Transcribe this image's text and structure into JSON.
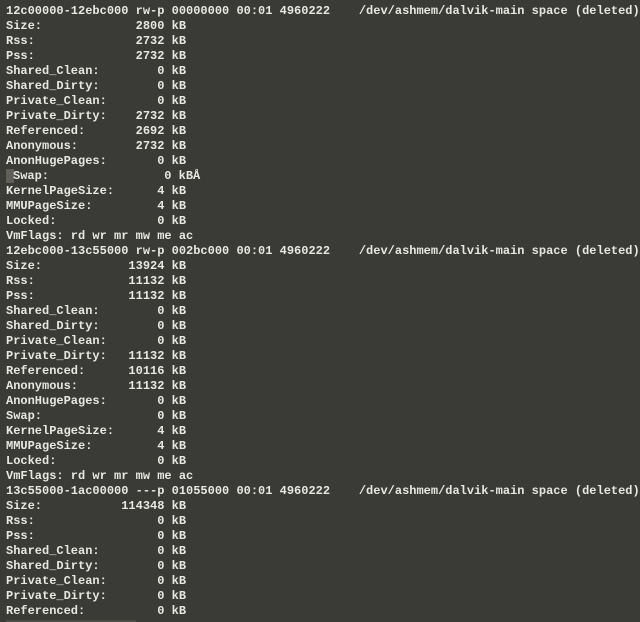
{
  "blocks": [
    {
      "header": "12c00000-12ebc000 rw-p 00000000 00:01 4960222    /dev/ashmem/dalvik-main space (deleted)",
      "entries": [
        {
          "label": "Size:",
          "value": "2800",
          "unit": "kB"
        },
        {
          "label": "Rss:",
          "value": "2732",
          "unit": "kB"
        },
        {
          "label": "Pss:",
          "value": "2732",
          "unit": "kB"
        },
        {
          "label": "Shared_Clean:",
          "value": "0",
          "unit": "kB"
        },
        {
          "label": "Shared_Dirty:",
          "value": "0",
          "unit": "kB"
        },
        {
          "label": "Private_Clean:",
          "value": "0",
          "unit": "kB"
        },
        {
          "label": "Private_Dirty:",
          "value": "2732",
          "unit": "kB"
        },
        {
          "label": "Referenced:",
          "value": "2692",
          "unit": "kB"
        },
        {
          "label": "Anonymous:",
          "value": "2732",
          "unit": "kB"
        },
        {
          "label": "AnonHugePages:",
          "value": "0",
          "unit": "kB"
        },
        {
          "label": "Swap:",
          "value": "0",
          "unit": "kBÅ",
          "highlight": true
        },
        {
          "label": "KernelPageSize:",
          "value": "4",
          "unit": "kB"
        },
        {
          "label": "MMUPageSize:",
          "value": "4",
          "unit": "kB"
        },
        {
          "label": "Locked:",
          "value": "0",
          "unit": "kB"
        }
      ],
      "footer": "VmFlags: rd wr mr mw me ac"
    },
    {
      "header": "12ebc000-13c55000 rw-p 002bc000 00:01 4960222    /dev/ashmem/dalvik-main space (deleted)",
      "entries": [
        {
          "label": "Size:",
          "value": "13924",
          "unit": "kB"
        },
        {
          "label": "Rss:",
          "value": "11132",
          "unit": "kB"
        },
        {
          "label": "Pss:",
          "value": "11132",
          "unit": "kB"
        },
        {
          "label": "Shared_Clean:",
          "value": "0",
          "unit": "kB"
        },
        {
          "label": "Shared_Dirty:",
          "value": "0",
          "unit": "kB"
        },
        {
          "label": "Private_Clean:",
          "value": "0",
          "unit": "kB"
        },
        {
          "label": "Private_Dirty:",
          "value": "11132",
          "unit": "kB"
        },
        {
          "label": "Referenced:",
          "value": "10116",
          "unit": "kB"
        },
        {
          "label": "Anonymous:",
          "value": "11132",
          "unit": "kB"
        },
        {
          "label": "AnonHugePages:",
          "value": "0",
          "unit": "kB"
        },
        {
          "label": "Swap:",
          "value": "0",
          "unit": "kB"
        },
        {
          "label": "KernelPageSize:",
          "value": "4",
          "unit": "kB"
        },
        {
          "label": "MMUPageSize:",
          "value": "4",
          "unit": "kB"
        },
        {
          "label": "Locked:",
          "value": "0",
          "unit": "kB"
        }
      ],
      "footer": "VmFlags: rd wr mr mw me ac"
    },
    {
      "header": "13c55000-1ac00000 ---p 01055000 00:01 4960222    /dev/ashmem/dalvik-main space (deleted)",
      "entries": [
        {
          "label": "Size:",
          "value": "114348",
          "unit": "kB"
        },
        {
          "label": "Rss:",
          "value": "0",
          "unit": "kB"
        },
        {
          "label": "Pss:",
          "value": "0",
          "unit": "kB"
        },
        {
          "label": "Shared_Clean:",
          "value": "0",
          "unit": "kB"
        },
        {
          "label": "Shared_Dirty:",
          "value": "0",
          "unit": "kB"
        },
        {
          "label": "Private_Clean:",
          "value": "0",
          "unit": "kB"
        },
        {
          "label": "Private_Dirty:",
          "value": "0",
          "unit": "kB"
        },
        {
          "label": "Referenced:",
          "value": "0",
          "unit": "kB"
        }
      ]
    }
  ]
}
